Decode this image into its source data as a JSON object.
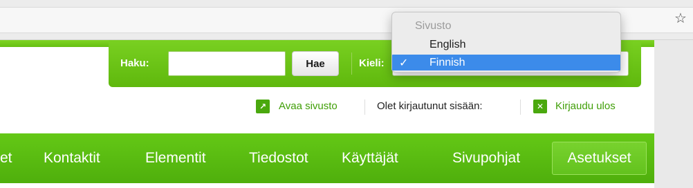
{
  "browser": {
    "bookmark_icon": "star-icon"
  },
  "search": {
    "label": "Haku:",
    "value": "",
    "button_label": "Hae"
  },
  "language": {
    "label": "Kieli:",
    "menu": {
      "group_label": "Sivusto",
      "options": [
        {
          "label": "English",
          "checked": false
        },
        {
          "label": "Finnish",
          "checked": true
        }
      ]
    }
  },
  "actions": {
    "open_site": {
      "label": "Avaa sivusto",
      "icon": "open-external-icon"
    },
    "logged_in_text": "Olet kirjautunut sisään:",
    "logout": {
      "label": "Kirjaudu ulos",
      "icon": "close-icon"
    }
  },
  "nav": {
    "items": [
      {
        "label": "et"
      },
      {
        "label": "Kontaktit"
      },
      {
        "label": "Elementit"
      },
      {
        "label": "Tiedostot"
      },
      {
        "label": "Käyttäjät"
      },
      {
        "label": "Sivupohjat"
      },
      {
        "label": "Asetukset",
        "active": true
      }
    ]
  },
  "colors": {
    "brand_green": "#5fb80d",
    "menu_highlight": "#3c8bea",
    "link_green": "#3f9e06"
  }
}
